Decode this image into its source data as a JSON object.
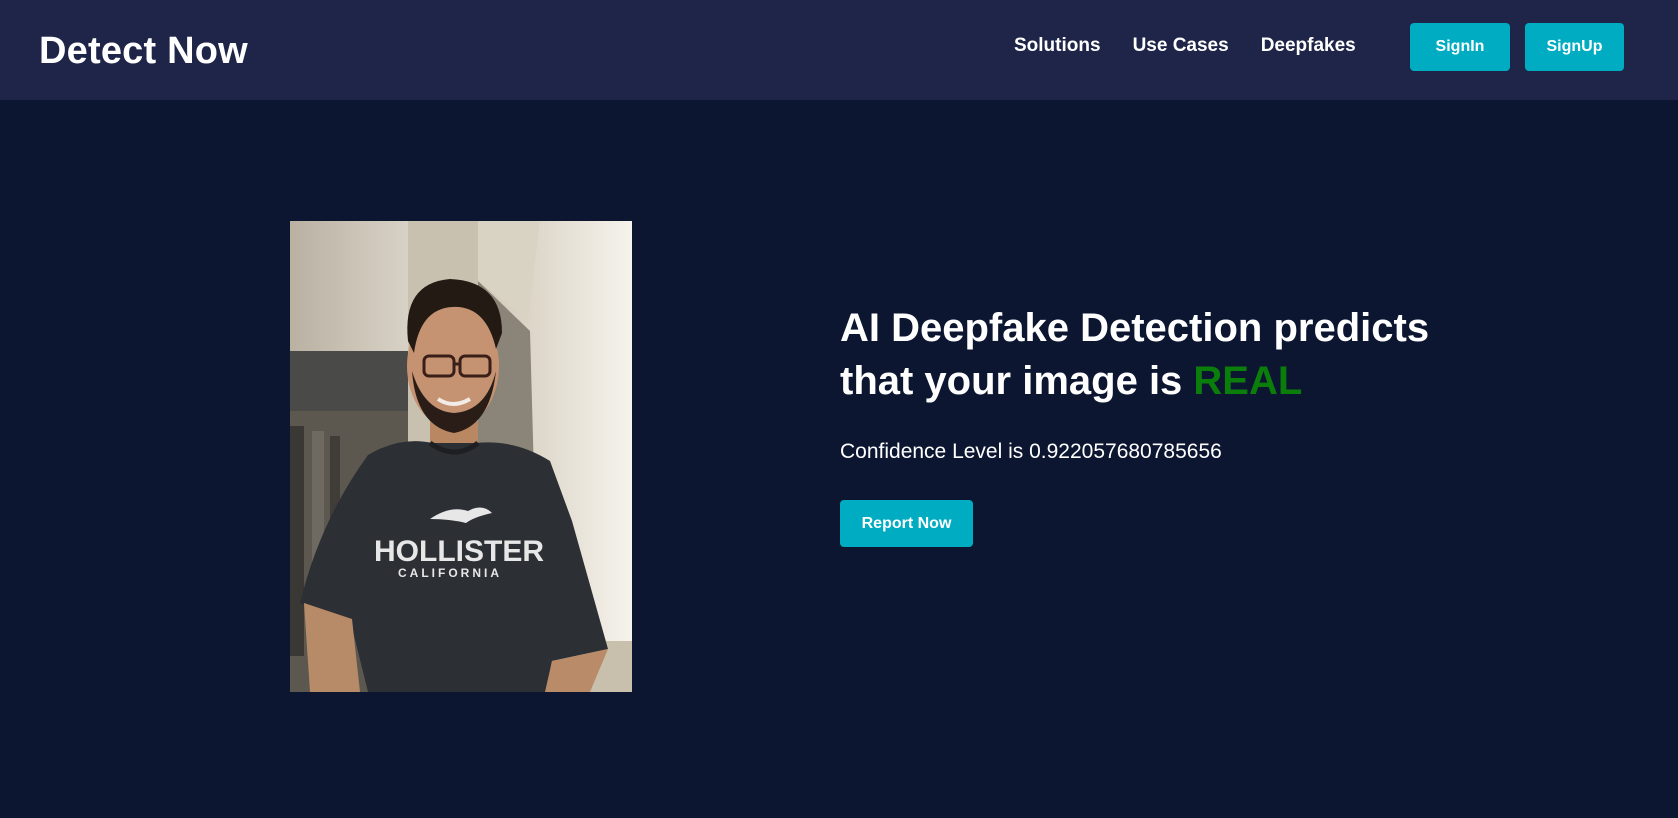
{
  "brand": "Detect Now",
  "nav": {
    "links": [
      "Solutions",
      "Use Cases",
      "Deepfakes"
    ],
    "signin_label": "SignIn",
    "signup_label": "SignUp"
  },
  "result": {
    "headline_line1": "AI Deepfake Detection predicts",
    "headline_line2_prefix": "that your image is ",
    "verdict": "REAL",
    "confidence_text": "Confidence Level is 0.922057680785656",
    "report_label": "Report Now"
  },
  "image": {
    "shirt_text": "HOLLISTER",
    "shirt_subtext": "CALIFORNIA"
  },
  "colors": {
    "header_bg": "#1e2548",
    "page_bg": "#0c1631",
    "accent": "#00acc1",
    "verdict_real": "#0b7d0b"
  }
}
